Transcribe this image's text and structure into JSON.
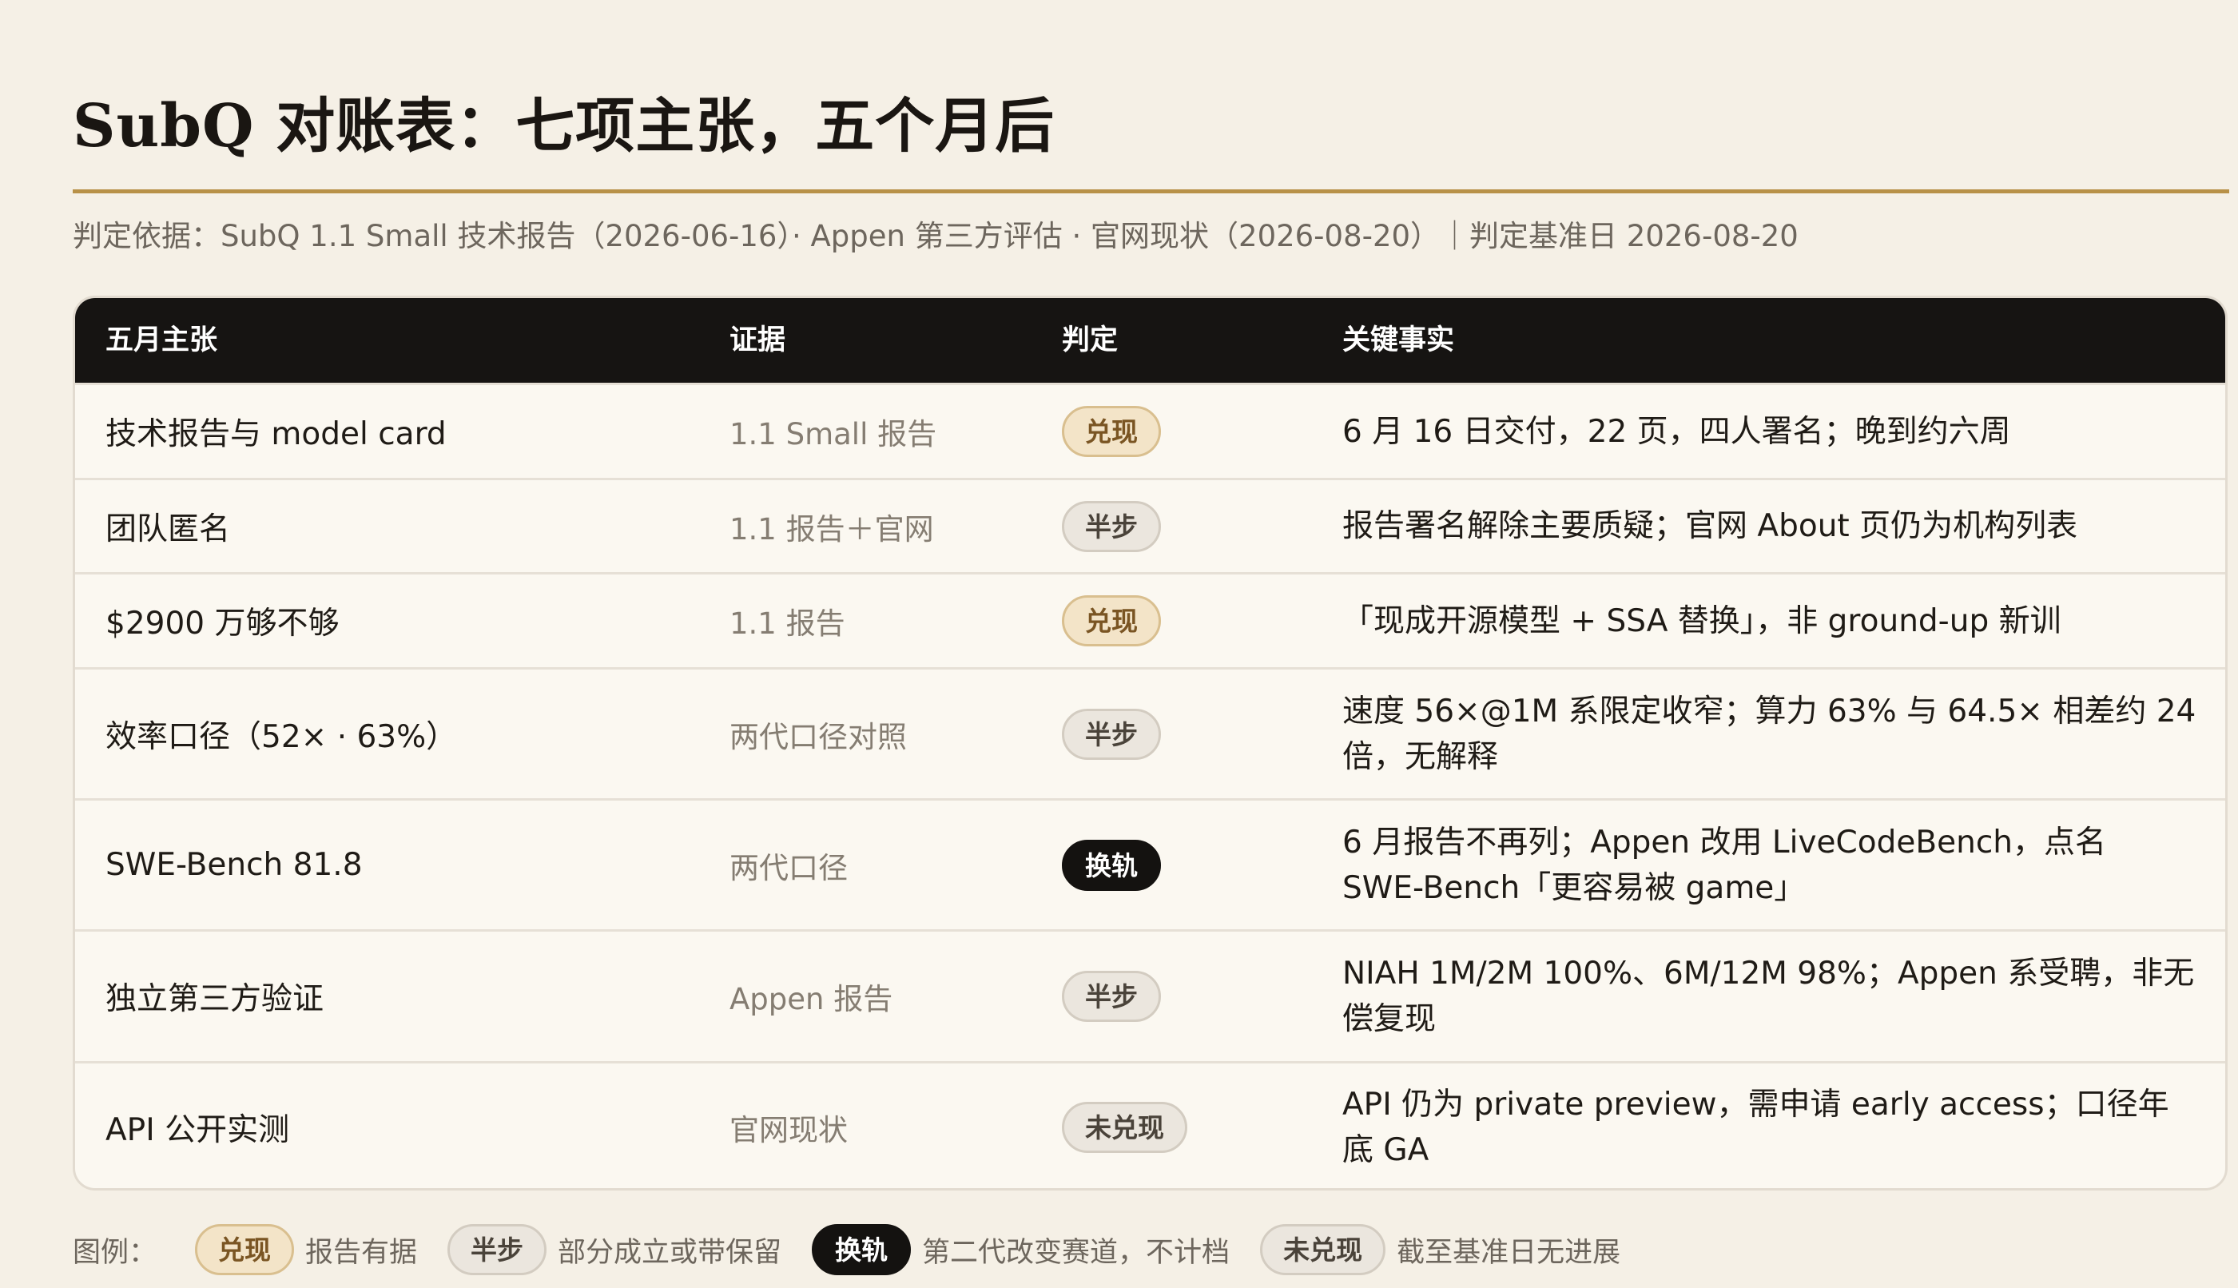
{
  "title": "SubQ 对账表：七项主张，五个月后",
  "basis": "判定依据：SubQ 1.1 Small 技术报告（2026-06-16）· Appen 第三方评估 · 官网现状（2026-08-20）｜判定基准日 2026-08-20",
  "table": {
    "headers": {
      "claim": "五月主张",
      "evidence": "证据",
      "verdict": "判定",
      "facts": "关键事实"
    },
    "rows": [
      {
        "claim": "技术报告与 model card",
        "evidence": "1.1 Small 报告",
        "verdict": "兑现",
        "facts": "6 月 16 日交付，22 页，四人署名；晚到约六周"
      },
      {
        "claim": "团队匿名",
        "evidence": "1.1 报告＋官网",
        "verdict": "半步",
        "facts": "报告署名解除主要质疑；官网 About 页仍为机构列表"
      },
      {
        "claim": "$2900 万够不够",
        "evidence": "1.1 报告",
        "verdict": "兑现",
        "facts": "「现成开源模型 + SSA 替换」，非 ground-up 新训"
      },
      {
        "claim": "效率口径（52× · 63%）",
        "evidence": "两代口径对照",
        "verdict": "半步",
        "facts": "速度 56×@1M 系限定收窄；算力 63% 与 64.5× 相差约 24 倍，无解释"
      },
      {
        "claim": "SWE-Bench 81.8",
        "evidence": "两代口径",
        "verdict": "换轨",
        "facts": "6 月报告不再列；Appen 改用 LiveCodeBench，点名 SWE-Bench「更容易被 game」"
      },
      {
        "claim": "独立第三方验证",
        "evidence": "Appen 报告",
        "verdict": "半步",
        "facts": "NIAH 1M/2M 100%、6M/12M 98%；Appen 系受聘，非无偿复现"
      },
      {
        "claim": "API 公开实测",
        "evidence": "官网现状",
        "verdict": "未兑现",
        "facts": "API 仍为 private preview，需申请 early access；口径年底 GA"
      }
    ]
  },
  "legend": {
    "label": "图例：",
    "items": [
      {
        "badge": "兑现",
        "desc": "报告有据"
      },
      {
        "badge": "半步",
        "desc": "部分成立或带保留"
      },
      {
        "badge": "换轨",
        "desc": "第二代改变赛道，不计档"
      },
      {
        "badge": "未兑现",
        "desc": "截至基准日无进展"
      }
    ]
  },
  "colors": {
    "background": "#f5f0e6",
    "accent_rule": "#b89148",
    "header_bg": "#161412",
    "badge_hit_bg": "#f3e4c8",
    "badge_half_bg": "#ebe6de",
    "badge_switch_bg": "#141210"
  }
}
